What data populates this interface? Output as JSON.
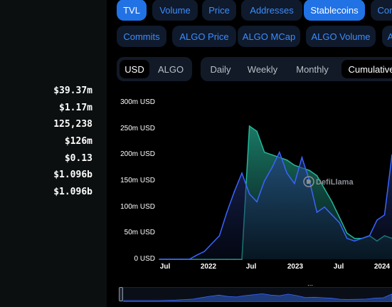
{
  "stats": [
    "$39.37m",
    "$1.17m",
    "125,238",
    "$126m",
    "$0.13",
    "$1.096b",
    "$1.096b"
  ],
  "tabs_row1": [
    {
      "label": "TVL",
      "active": true
    },
    {
      "label": "Volume",
      "active": false
    },
    {
      "label": "Price",
      "active": false
    },
    {
      "label": "Addresses",
      "active": false
    },
    {
      "label": "Stablecoins",
      "active": true
    },
    {
      "label": "Cor",
      "active": false
    }
  ],
  "tabs_row2": [
    {
      "label": "Commits",
      "active": false
    },
    {
      "label": "ALGO Price",
      "active": false
    },
    {
      "label": "ALGO MCap",
      "active": false
    },
    {
      "label": "ALGO Volume",
      "active": false
    },
    {
      "label": "A",
      "active": false
    }
  ],
  "currency_toggle": {
    "options": [
      "USD",
      "ALGO"
    ],
    "selected": "USD"
  },
  "period_toggle": {
    "options": [
      "Daily",
      "Weekly",
      "Monthly",
      "Cumulative"
    ],
    "selected": "Cumulative"
  },
  "watermark": "DefiLlama",
  "colors": {
    "accent": "#2172e5",
    "series_blue": "#3b63ff",
    "series_green": "#25b79a"
  },
  "chart_data": {
    "type": "area",
    "title": "",
    "xlabel": "",
    "ylabel": "",
    "y_ticks": [
      "0 USD",
      "50m USD",
      "100m USD",
      "150m USD",
      "200m USD",
      "250m USD",
      "300m USD"
    ],
    "x_ticks": [
      "Jul",
      "2022",
      "Jul",
      "2023",
      "Jul",
      "2024"
    ],
    "ylim": [
      0,
      300
    ],
    "y_unit": "million USD",
    "grid": false,
    "legend": "none",
    "x": [
      "2021-06",
      "2021-07",
      "2021-08",
      "2021-09",
      "2021-10",
      "2021-11",
      "2021-12",
      "2022-01",
      "2022-02",
      "2022-03",
      "2022-04",
      "2022-05",
      "2022-06",
      "2022-07",
      "2022-08",
      "2022-09",
      "2022-10",
      "2022-11",
      "2022-12",
      "2023-01",
      "2023-02",
      "2023-03",
      "2023-04",
      "2023-05",
      "2023-06",
      "2023-07",
      "2023-08",
      "2023-09",
      "2023-10",
      "2023-11",
      "2023-12",
      "2024-01"
    ],
    "series": [
      {
        "values": [
          0,
          0,
          0,
          0,
          0,
          8,
          15,
          30,
          45,
          90,
          130,
          165,
          125,
          110,
          150,
          175,
          205,
          165,
          145,
          195,
          150,
          90,
          100,
          85,
          70,
          40,
          35,
          40,
          45,
          75,
          85,
          200
        ]
      },
      {
        "values": [
          0,
          0,
          0,
          0,
          0,
          0,
          0,
          0,
          0,
          0,
          0,
          0,
          255,
          245,
          205,
          200,
          195,
          190,
          180,
          175,
          170,
          160,
          135,
          110,
          80,
          50,
          40,
          40,
          45,
          35,
          45,
          40
        ]
      }
    ]
  }
}
